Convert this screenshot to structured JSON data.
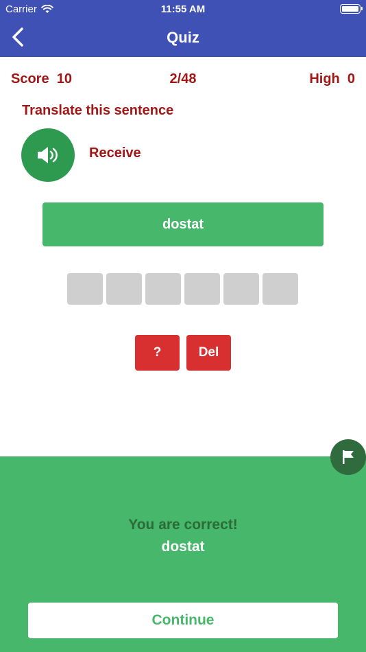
{
  "status_bar": {
    "carrier": "Carrier",
    "time": "11:55 AM"
  },
  "nav": {
    "title": "Quiz"
  },
  "scoreboard": {
    "score": "Score  10",
    "progress": "2/48",
    "high": "High  0"
  },
  "prompt": "Translate this sentence",
  "word": "Receive",
  "answer": "dostat",
  "letter_slots": 6,
  "buttons": {
    "hint": "?",
    "delete": "Del",
    "continue": "Continue"
  },
  "result": {
    "message": "You are correct!",
    "word": "dostat"
  },
  "colors": {
    "header": "#3f51b5",
    "accent_red": "#a31616",
    "button_red": "#d83030",
    "green": "#47b76b",
    "dark_green": "#2e9a4f",
    "flag_green": "#2f6b3c",
    "slot_gray": "#cfcfcf"
  },
  "icons": {
    "back": "chevron-left-icon",
    "speaker": "speaker-icon",
    "flag": "flag-icon",
    "wifi": "wifi-icon",
    "battery": "battery-icon"
  }
}
